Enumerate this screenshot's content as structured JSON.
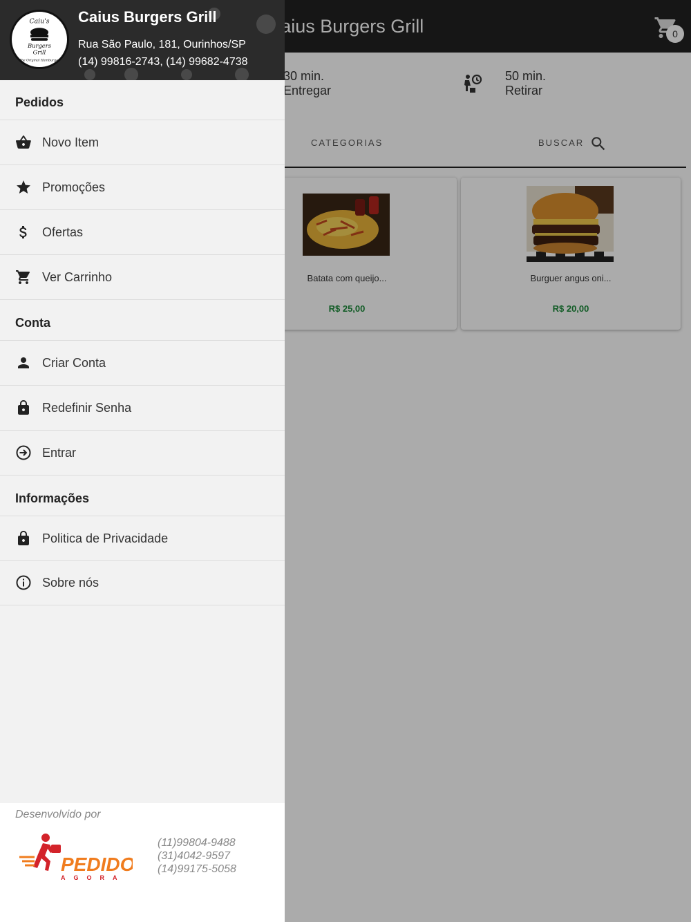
{
  "app": {
    "title": "Caius Burgers Grill",
    "cart_count": "0",
    "delivery": {
      "time": "30 min.",
      "label": "Entregar"
    },
    "pickup": {
      "time": "50 min.",
      "label": "Retirar"
    },
    "tabs": {
      "categorias": "CATEGORIAS",
      "buscar": "BUSCAR"
    },
    "products": [
      {
        "name": "Batata com queijo...",
        "price": "R$ 25,00"
      },
      {
        "name": "Burguer angus oni...",
        "price": "R$ 20,00"
      }
    ]
  },
  "drawer": {
    "store": {
      "name": "Caius Burgers Grill",
      "address": "Rua São Paulo, 181, Ourinhos/SP",
      "phones": "(14) 99816-2743, (14) 99682-4738",
      "logo_text": [
        "Caiu's",
        "Burgers",
        "Grill",
        "The Original Hamburger"
      ]
    },
    "sections": {
      "pedidos": "Pedidos",
      "conta": "Conta",
      "informacoes": "Informações"
    },
    "items": {
      "novo_item": {
        "label": "Novo Item",
        "icon": "basket-icon"
      },
      "promocoes": {
        "label": "Promoções",
        "icon": "star-icon"
      },
      "ofertas": {
        "label": "Ofertas",
        "icon": "dollar-icon"
      },
      "ver_carrinho": {
        "label": "Ver Carrinho",
        "icon": "cart-icon"
      },
      "criar_conta": {
        "label": "Criar Conta",
        "icon": "person-icon"
      },
      "redefinir_senha": {
        "label": "Redefinir Senha",
        "icon": "lock-icon"
      },
      "entrar": {
        "label": "Entrar",
        "icon": "login-icon"
      },
      "politica": {
        "label": "Politica de Privacidade",
        "icon": "lock-icon"
      },
      "sobre": {
        "label": "Sobre nós",
        "icon": "info-icon"
      }
    },
    "footer": {
      "label": "Desenvolvido por",
      "brand": "PEDIDO",
      "brand_sub": "AGORA",
      "phones": [
        "(11)99804-9488",
        "(31)4042-9597",
        "(14)99175-5058"
      ]
    }
  },
  "colors": {
    "app_bar": "#212121",
    "price_green": "#1b8a3a",
    "brand_orange": "#f07c1e",
    "brand_red": "#d3232a"
  }
}
